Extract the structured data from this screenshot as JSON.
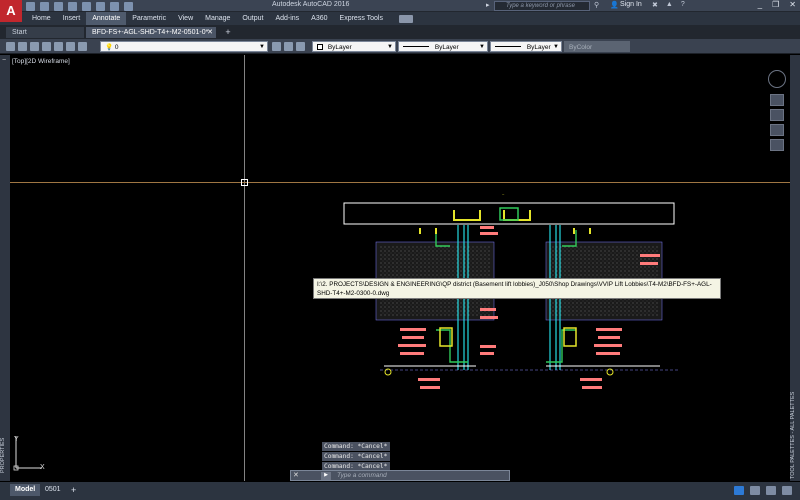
{
  "titlebar": {
    "app_logo": "A",
    "title": "Autodesk AutoCAD 2016",
    "search_placeholder": "Type a keyword or phrase",
    "signin": "Sign In"
  },
  "ribbon": {
    "tabs": [
      "Home",
      "Insert",
      "Annotate",
      "Parametric",
      "View",
      "Manage",
      "Output",
      "Add-ins",
      "A360",
      "Express Tools"
    ],
    "active_tab": "Annotate"
  },
  "file_tabs": {
    "start": "Start",
    "active": "BFD-FS+-AGL-SHD-T4+-M2-0501-0*"
  },
  "toolbar": {
    "layer": "0",
    "color": "ByLayer",
    "linetype": "ByLayer",
    "lineweight": "ByLayer",
    "plotstyle": "ByColor"
  },
  "viewport": {
    "label": "[Top][2D Wireframe]",
    "close": "−"
  },
  "tooltip": {
    "path": "I:\\2. PROJECTS\\DESIGN & ENGINEERING\\QP district (Basement lift lobbies)_J050\\Shop Drawings\\VVIP Lift Lobbies\\T4-M2\\BFD-FS+-AGL-SHD-T4+-M2-0300-0.dwg"
  },
  "palettes": {
    "properties": "PROPERTIES",
    "tool_palettes": "TOOL PALETTES - ALL PALETTES"
  },
  "ucs": {
    "y": "Y",
    "x": "X"
  },
  "command": {
    "history": [
      "Command: *Cancel*",
      "Command: *Cancel*",
      "Command: *Cancel*"
    ],
    "placeholder": "Type a command"
  },
  "status": {
    "model": "Model",
    "layout": "0501"
  },
  "colors": {
    "accent_red": "#c1272d",
    "drawing_yellow": "#e5e52a",
    "drawing_green": "#31c95a",
    "drawing_cyan": "#24d8e0",
    "drawing_tag": "#ff7b7b"
  }
}
